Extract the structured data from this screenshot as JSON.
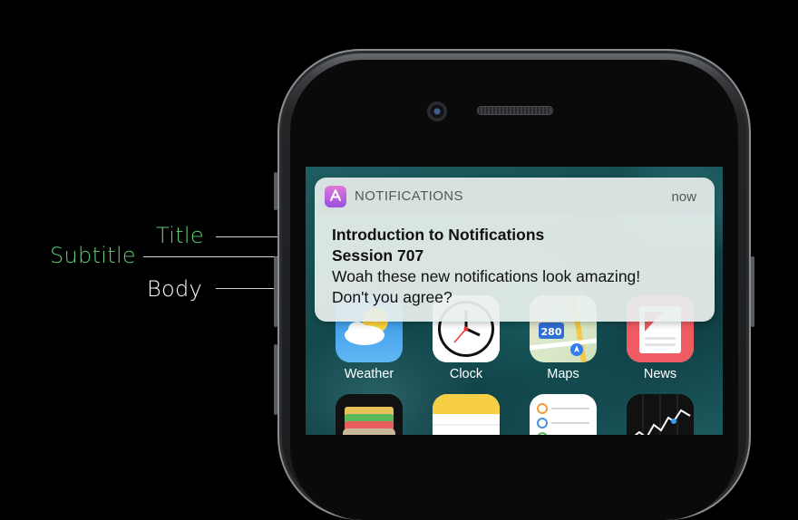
{
  "callouts": {
    "title": {
      "label": "Title",
      "color": "#5fcf72"
    },
    "subtitle": {
      "label": "Subtitle",
      "color": "#5fcf72"
    },
    "body": {
      "label": "Body",
      "color": "#ffffff"
    }
  },
  "notification": {
    "app_name": "NOTIFICATIONS",
    "time": "now",
    "title": "Introduction to Notifications",
    "subtitle": "Session 707",
    "body_line1": "Woah these new notifications look amazing!",
    "body_line2": "Don't you agree?",
    "icon": "app-store-icon"
  },
  "home_screen": {
    "row1": [
      {
        "label": "Weather",
        "icon": "weather-icon"
      },
      {
        "label": "Clock",
        "icon": "clock-icon"
      },
      {
        "label": "Maps",
        "icon": "maps-icon"
      },
      {
        "label": "News",
        "icon": "news-icon"
      }
    ],
    "row2": [
      {
        "icon": "wallet-icon"
      },
      {
        "icon": "notes-icon"
      },
      {
        "icon": "reminders-icon"
      },
      {
        "icon": "stocks-icon"
      }
    ],
    "maps_shield": "280"
  },
  "colors": {
    "background": "#000000",
    "accent_green": "#5fcf72"
  }
}
